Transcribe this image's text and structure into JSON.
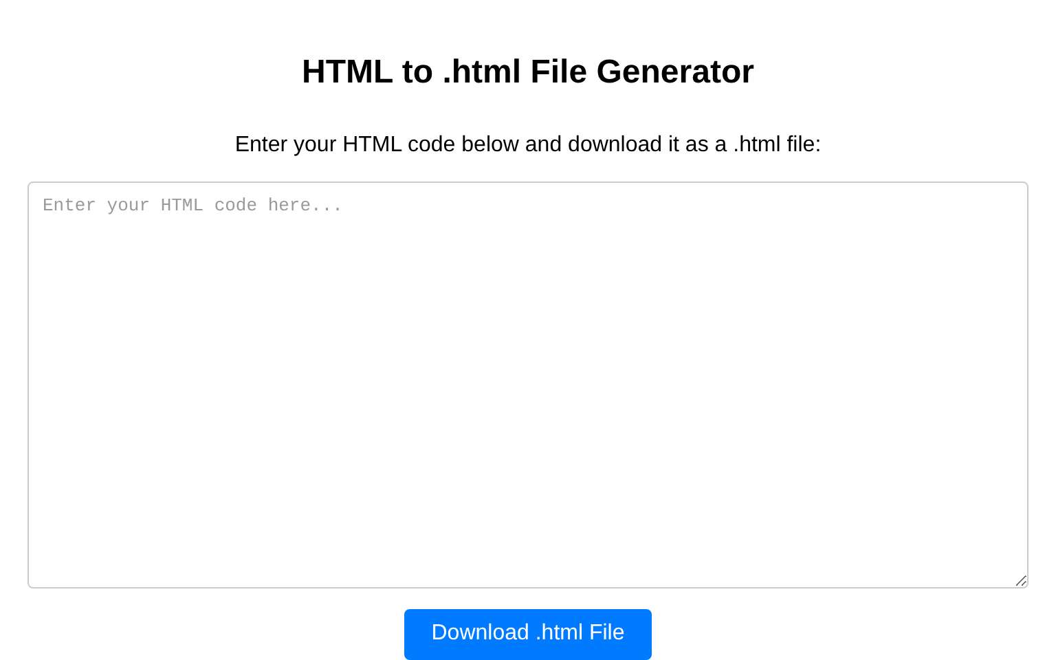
{
  "title": "HTML to .html File Generator",
  "subtitle": "Enter your HTML code below and download it as a .html file:",
  "editor": {
    "placeholder": "Enter your HTML code here..."
  },
  "download_button": {
    "label": "Download .html File"
  }
}
